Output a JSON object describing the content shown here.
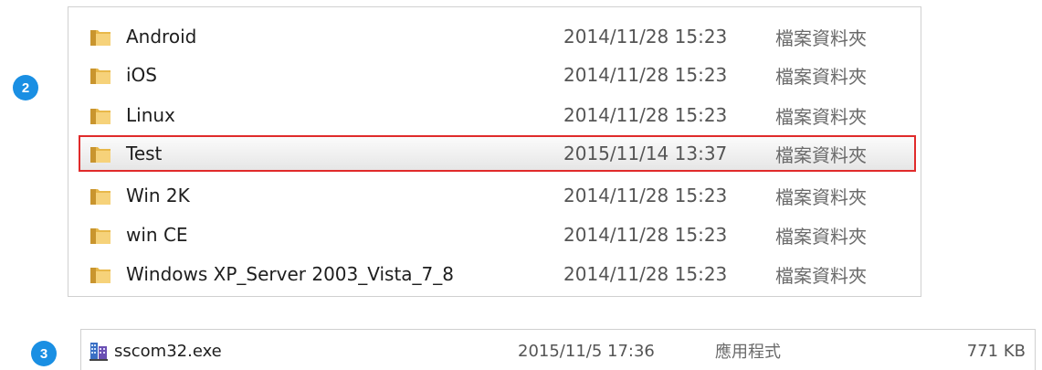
{
  "badges": {
    "step2": "2",
    "step3": "3"
  },
  "folders": [
    {
      "name": "Android",
      "date": "2014/11/28 15:23",
      "type": "檔案資料夾",
      "selected": false
    },
    {
      "name": "iOS",
      "date": "2014/11/28 15:23",
      "type": "檔案資料夾",
      "selected": false
    },
    {
      "name": "Linux",
      "date": "2014/11/28 15:23",
      "type": "檔案資料夾",
      "selected": false
    },
    {
      "name": "Test",
      "date": "2015/11/14 13:37",
      "type": "檔案資料夾",
      "selected": true
    },
    {
      "name": "Win 2K",
      "date": "2014/11/28 15:23",
      "type": "檔案資料夾",
      "selected": false
    },
    {
      "name": "win CE",
      "date": "2014/11/28 15:23",
      "type": "檔案資料夾",
      "selected": false
    },
    {
      "name": "Windows XP_Server 2003_Vista_7_8",
      "date": "2014/11/28 15:23",
      "type": "檔案資料夾",
      "selected": false
    }
  ],
  "file": {
    "name": "sscom32.exe",
    "date": "2015/11/5 17:36",
    "type": "應用程式",
    "size": "771 KB"
  },
  "colors": {
    "badge": "#1a8fe3",
    "highlight_border": "#e02b2b",
    "folder": "#e8b84a"
  },
  "icons": {
    "folder": "folder-icon",
    "app": "application-icon"
  }
}
